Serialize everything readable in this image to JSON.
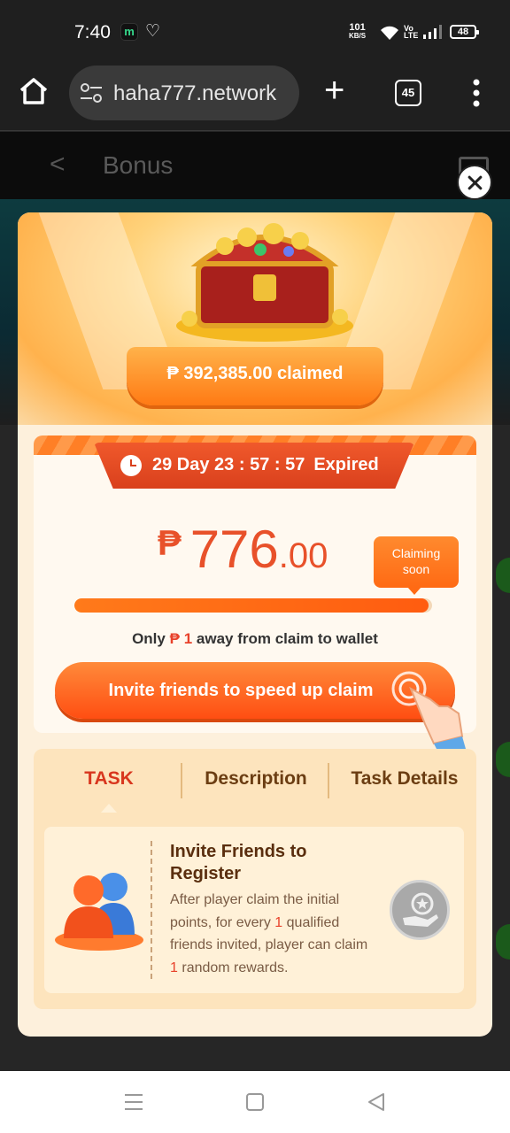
{
  "status_bar": {
    "time": "7:40",
    "app_badge": "m",
    "net_speed_value": "101",
    "net_speed_unit": "KB/S",
    "volte_top": "Vo",
    "volte_bottom": "LTE",
    "battery": "48"
  },
  "browser": {
    "url": "haha777.network",
    "tab_count": "45"
  },
  "page": {
    "title": "Bonus"
  },
  "modal": {
    "claimed": "₱ 392,385.00 claimed",
    "timer": "29 Day 23 : 57 : 57",
    "timer_status": "Expired",
    "currency": "₱",
    "amount_int": "776",
    "amount_dec": ".00",
    "badge_line1": "Claiming",
    "badge_line2": "soon",
    "progress_fraction": 0.99,
    "away_prefix": "Only",
    "away_currency": "₱",
    "away_amount": "1",
    "away_suffix": "away from claim to wallet",
    "invite_button": "Invite friends to speed up claim",
    "tabs": [
      "TASK",
      "Description",
      "Task Details"
    ],
    "task": {
      "title": "Invite Friends to Register",
      "desc_1": "After player claim the initial points, for every",
      "desc_count_1": "1",
      "desc_2": "qualified friends invited, player can claim",
      "desc_count_2": "1",
      "desc_3": "random rewards."
    }
  },
  "colors": {
    "accent_orange": "#ff6a14",
    "accent_red": "#e8512a",
    "modal_bg": "#fdf0dc"
  }
}
